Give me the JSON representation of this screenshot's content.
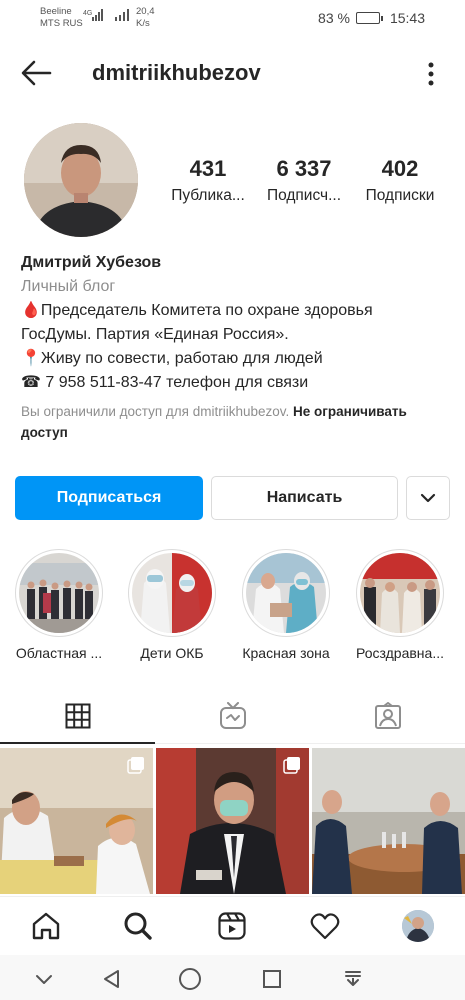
{
  "status_bar": {
    "carrier_line1": "Beeline",
    "carrier_line2": "MTS RUS",
    "network": "4G",
    "speed_line1": "20,4",
    "speed_line2": "K/s",
    "battery": "83 %",
    "battery_level": 0.83,
    "time": "15:43"
  },
  "header": {
    "username": "dmitriikhubezov",
    "back_icon": "arrow-left-icon",
    "more_icon": "kebab-menu-icon"
  },
  "profile": {
    "stats": [
      {
        "value": "431",
        "label": "Публика..."
      },
      {
        "value": "6 337",
        "label": "Подписч..."
      },
      {
        "value": "402",
        "label": "Подписки"
      }
    ],
    "name": "Дмитрий Хубезов",
    "category": "Личный блог",
    "bio_lines": [
      "🩸Председатель Комитета по охране здоровья",
      "ГосДумы. Партия «Единая Россия».",
      "📍Живу по совести, работаю для людей",
      "☎ 7 958 511-83-47 телефон для связи"
    ],
    "restrict_text": "Вы ограничили доступ для dmitriikhubezov.",
    "restrict_link": "Не ограничивать доступ"
  },
  "buttons": {
    "follow": "Подписаться",
    "message": "Написать",
    "more_icon": "chevron-down-icon"
  },
  "highlights": [
    {
      "label": "Областная ..."
    },
    {
      "label": "Дети ОКБ"
    },
    {
      "label": "Красная зона"
    },
    {
      "label": "Росздравна..."
    }
  ],
  "tabs": [
    {
      "icon": "grid-icon",
      "active": true
    },
    {
      "icon": "igtv-icon",
      "active": false
    },
    {
      "icon": "tagged-icon",
      "active": false
    }
  ],
  "bottom_nav": [
    "home-icon",
    "search-icon",
    "reels-icon",
    "heart-icon",
    "profile-avatar"
  ],
  "system_nav": [
    "chevron-down-icon",
    "back-triangle-icon",
    "home-circle-icon",
    "recents-square-icon",
    "notification-pull-icon"
  ],
  "colors": {
    "accent": "#0095f6",
    "text": "#262626",
    "secondary": "#8e8e8e",
    "border": "#dbdbdb"
  }
}
